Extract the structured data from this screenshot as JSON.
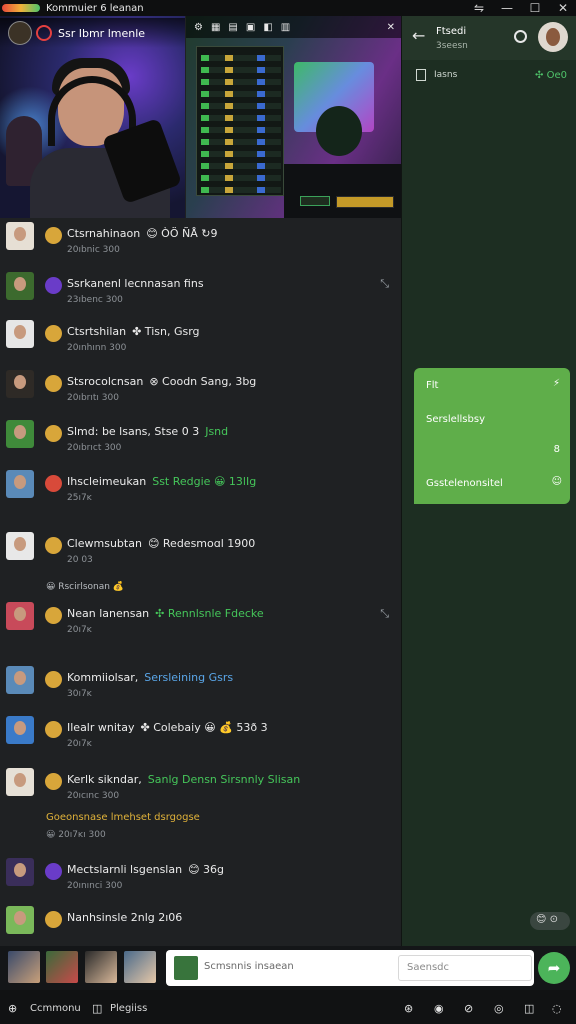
{
  "window": {
    "title": "Kommuier 6 leanan",
    "controls": [
      "⇋",
      "—",
      "☐",
      "✕"
    ]
  },
  "stream": {
    "camera_label": "Ssr Ibmr lmenle",
    "game_close": "✕"
  },
  "messages": [
    {
      "name": "Ctsrnahinaon",
      "tag": "😊 ÒÖ ÑÅ ↻9",
      "tag_color": "#e9e9e9",
      "sub": "20ıbnic 300",
      "avatar_color": "#e6dfd4",
      "emoji_color": "#d8a63a"
    },
    {
      "name": "Ssrkanenl lecnnasan fins",
      "tag": "",
      "tag_color": "#e9e9e9",
      "sub": "23ıbenc 300",
      "avatar_color": "#3c6a2e",
      "emoji_color": "#6a3cc8",
      "right_icon": "⤡"
    },
    {
      "name": "Ctsrtshilan",
      "tag": "✤ Tisn, Gsrg",
      "tag_color": "#e9e9e9",
      "sub": "20ınhınn 300",
      "avatar_color": "#e6e6e6",
      "emoji_color": "#d8a63a"
    },
    {
      "name": "Stsrocolcnsan",
      "tag": "⊗ Coodn Sang, 3bg",
      "tag_color": "#e9e9e9",
      "sub": "20ıbrıtı 300",
      "avatar_color": "#2e2a26",
      "emoji_color": "#d8a63a"
    },
    {
      "name": "Slmd: be lsans, Stse 0 3",
      "tag": "Jsnd",
      "tag_color": "#45c65a",
      "sub": "20ıbrıct 300",
      "avatar_color": "#3f8a3a",
      "emoji_color": "#d8a63a"
    },
    {
      "name": "Ihscleimeukan",
      "tag": "Sst Redgie 😀 13lIg",
      "tag_color": "#45c65a",
      "sub": "25ı7ĸ",
      "avatar_color": "#5a8ab8",
      "emoji_color": "#d84a3a"
    },
    {
      "name": "Clewmsubtan",
      "tag": "😊 Redesmoɑl 1900",
      "tag_color": "#e9e9e9",
      "sub": "20 03",
      "avatar_color": "#e8e8e8",
      "emoji_color": "#d8a63a"
    },
    {
      "name": "Nean lanensan",
      "tag": "✣ Rennlsnle Fdecke",
      "tag_color": "#45c65a",
      "sub": "20ı7ĸ",
      "avatar_color": "#c84a5a",
      "emoji_color": "#d8a63a",
      "right_icon": "⤡"
    },
    {
      "name": "Kommiiolsar,",
      "tag": "Sersleining Gsrs",
      "tag_color": "#5aa6e8",
      "sub": "30ı7ĸ",
      "avatar_color": "#5a8ab8",
      "emoji_color": "#d8a63a"
    },
    {
      "name": "Ilealr wnitay",
      "tag": "✤ Colebaiy 😀 💰 53ð 3",
      "tag_color": "#e9e9e9",
      "sub": "20ı7ĸ",
      "avatar_color": "#3a7ac8",
      "emoji_color": "#d8a63a"
    },
    {
      "name": "Kerlk sikndar,",
      "tag": "Sanlg Densn Sirsnnly  Slisan",
      "tag_color": "#45c65a",
      "sub": "20ıcınc 300",
      "avatar_color": "#e6e0d6",
      "emoji_color": "#d8a63a"
    },
    {
      "name": "Mectslarnli lsgenslan",
      "tag": "😊 36g",
      "tag_color": "#e9e9e9",
      "sub": "20ınınci 300",
      "avatar_color": "#3a2e5a",
      "emoji_color": "#6a3cc8"
    },
    {
      "name": "Nanhsinsle 2nlg 2ı06",
      "tag": "",
      "tag_color": "#e9e9e9",
      "sub": "",
      "avatar_color": "#7ab85a",
      "emoji_color": "#d8a63a"
    }
  ],
  "system_lines": [
    {
      "text": "😀 Rscirlsonan 💰",
      "color": "#b8bcc0"
    },
    {
      "text": "Goeonsnase lmehset dsrgogse",
      "color": "#e0b23a"
    },
    {
      "text": "😀 20ı7ĸı 300",
      "color": "#8d9297"
    }
  ],
  "right_panel": {
    "header_title": "Ftsedi",
    "header_sub": "3seesn",
    "tab_label": "Iasns",
    "tab_green": "✣ Oe0",
    "bubble": {
      "line1": "Flt",
      "line1_icon": "⚡",
      "line2": "Serslellsbsy",
      "line3": "Gsstelenonsitel",
      "line3_icon": "☺"
    },
    "chip": "😊 ⊙"
  },
  "composer": {
    "placeholder": "Scmsnnis insaean",
    "secondary_placeholder": "Saensdc",
    "send_icon": "➦"
  },
  "bottom_bar": {
    "left_label_1": "Ccmmonu",
    "left_label_2": "Plegiiss",
    "right_icons": [
      "⊛",
      "◉",
      "⊘",
      "◎",
      "◫",
      "◌"
    ]
  },
  "colors": {
    "background": "#1f2123",
    "right_panel": "#1d2e22",
    "bubble": "#5fae4a",
    "accent_green": "#45c65a"
  }
}
